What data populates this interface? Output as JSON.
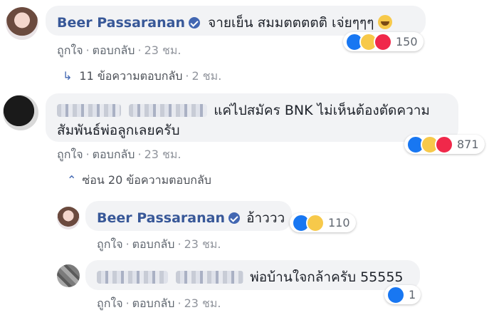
{
  "comments": [
    {
      "name": "Beer Passaranan",
      "text": "จายเย็น สมมตตตตติ เจ่ยๆๆๆ",
      "reaction_count": "150",
      "actions": {
        "like": "ถูกใจ",
        "reply": "ตอบกลับ",
        "time": "23 ชม."
      },
      "replies_link": {
        "label": "11 ข้อความตอบกลับ",
        "time": "2 ชม."
      }
    },
    {
      "text_line1": "แค่ไปสมัคร BNK ไม่เห็นต้องตัดความ",
      "text_line2": "สัมพันธ์พ่อลูกเลยครับ",
      "reaction_count": "871",
      "actions": {
        "like": "ถูกใจ",
        "reply": "ตอบกลับ",
        "time": "23 ชม."
      },
      "hide_link": "ซ่อน 20 ข้อความตอบกลับ"
    }
  ],
  "replies": [
    {
      "name": "Beer Passaranan",
      "text": "อ้าววว",
      "reaction_count": "110",
      "actions": {
        "like": "ถูกใจ",
        "reply": "ตอบกลับ",
        "time": "23 ชม."
      }
    },
    {
      "text": "พ่อบ้านใจกล้าครับ 55555",
      "reaction_count": "1",
      "actions": {
        "like": "ถูกใจ",
        "reply": "ตอบกลับ",
        "time": "23 ชม."
      }
    }
  ],
  "icons": {
    "verified": "verified-badge-icon",
    "like": "like-reaction-icon",
    "haha": "haha-reaction-icon",
    "love": "love-reaction-icon",
    "reply_arrow": "reply-arrow-icon",
    "collapse": "chevron-up-icon"
  },
  "colors": {
    "name": "#385898",
    "bubble": "#f2f3f5",
    "like": "#1877f2",
    "haha": "#f7c94a",
    "love": "#f0284a"
  }
}
